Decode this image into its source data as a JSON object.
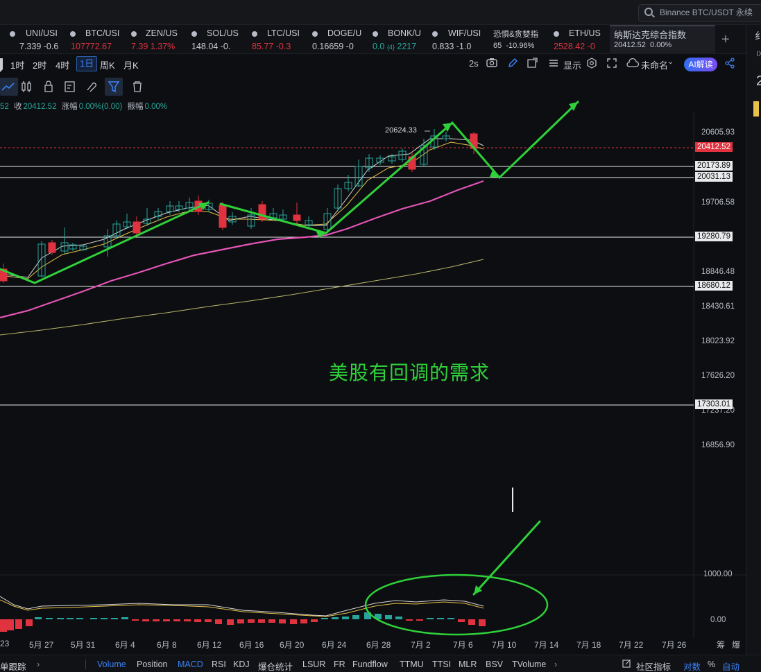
{
  "search": {
    "placeholder": "Binance BTC/USDT 永续"
  },
  "tickers": [
    {
      "name": "UNI/USI",
      "price": "7.339",
      "change": "-0.6",
      "price_color": "#c9ccd3",
      "change_color": "#c9ccd3"
    },
    {
      "name": "BTC/USI",
      "price": "107772.67",
      "change": "",
      "price_color": "#e0333f",
      "change_color": "#e0333f"
    },
    {
      "name": "ZEN/US",
      "price": "7.39",
      "change": "1.37%",
      "price_color": "#e0333f",
      "change_color": "#e0333f"
    },
    {
      "name": "SOL/US",
      "price": "148.04",
      "change": "-0.",
      "price_color": "#c9ccd3",
      "change_color": "#c9ccd3"
    },
    {
      "name": "LTC/USI",
      "price": "85.77",
      "change": "-0.3",
      "price_color": "#e0333f",
      "change_color": "#e0333f"
    },
    {
      "name": "DOGE/U",
      "price": "0.16659",
      "change": "-0",
      "price_color": "#c9ccd3",
      "change_color": "#c9ccd3"
    },
    {
      "name": "BONK/U",
      "price": "0.0",
      "change": "2217",
      "extra": "{4}",
      "price_color": "#26a69a",
      "change_color": "#26a69a"
    },
    {
      "name": "WIF/USI",
      "price": "0.833",
      "change": "-1.0",
      "price_color": "#c9ccd3",
      "change_color": "#c9ccd3"
    },
    {
      "name": "恐惧&贪婪指",
      "price": "65",
      "change": "-10.96%",
      "price_color": "#c9ccd3",
      "change_color": "#c9ccd3"
    },
    {
      "name": "ETH/US",
      "price": "2528.42",
      "change": "-0",
      "price_color": "#e0333f",
      "change_color": "#e0333f"
    },
    {
      "name": "纳斯达克综合指数",
      "price": "20412.52",
      "change": "0.00%",
      "price_color": "#c9ccd3",
      "change_color": "#c9ccd3"
    }
  ],
  "timeframes": [
    "1时",
    "2时",
    "4时",
    "1日",
    "周K",
    "月K"
  ],
  "active_timeframe": "1日",
  "toolbar_right": {
    "interval": "2s",
    "display": "显示",
    "layout": "未命名",
    "ai": "AI解读"
  },
  "ohlc": {
    "prefix": "52",
    "close_label": "收",
    "close": "20412.52",
    "change_label": "涨幅",
    "change": "0.00%(0.00)",
    "amp_label": "振幅",
    "amp": "0.00%"
  },
  "price_labels": [
    "20605.93",
    "19706.58",
    "18846.48",
    "18430.61",
    "18023.92",
    "17626.20",
    "17237.20",
    "16856.90"
  ],
  "level_labels": [
    {
      "value": "20412.52",
      "style": "red"
    },
    {
      "value": "20173.89",
      "style": "plain"
    },
    {
      "value": "20031.13",
      "style": "plain"
    },
    {
      "value": "19280.79",
      "style": "plain"
    },
    {
      "value": "18680.12",
      "style": "plain"
    },
    {
      "value": "17303.01",
      "style": "plain"
    }
  ],
  "high_marker": "20624.33",
  "annotation_text": "美股有回调的需求",
  "macd_labels": [
    "1000.00",
    "0.00"
  ],
  "x_labels": [
    "23",
    "5月 27",
    "5月 31",
    "6月 4",
    "6月 8",
    "6月 12",
    "6月 16",
    "6月 20",
    "6月 24",
    "6月 28",
    "7月 2",
    "7月 6",
    "7月 10",
    "7月 14",
    "7月 18",
    "7月 22",
    "7月 26"
  ],
  "x_right": [
    "筹",
    "爆"
  ],
  "bottom_tabs": [
    "单跟踪",
    "Volume",
    "Position",
    "MACD",
    "RSI",
    "KDJ",
    "爆仓统计",
    "LSUR",
    "FR",
    "Fundflow",
    "TTMU",
    "TTSI",
    "MLR",
    "BSV",
    "TVolume"
  ],
  "bottom_active": [
    "Volume",
    "MACD"
  ],
  "bottom_right": {
    "community": "社区指标",
    "log": "对数",
    "pct": "%",
    "auto": "自动"
  },
  "colors": {
    "up": "#26a69a",
    "down": "#e0333f",
    "accent": "#3b82f6",
    "annotation": "#2fd13a",
    "ma_long": "#e455b7"
  }
}
